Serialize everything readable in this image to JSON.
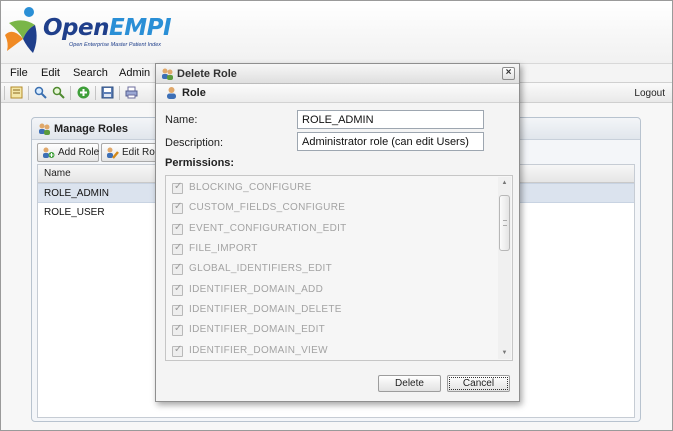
{
  "app": {
    "logo_text_a": "Open",
    "logo_text_b": "EMPI",
    "logo_subtitle": "Open Enterprise Master Patient Index",
    "brand_colors": {
      "dark_blue": "#1f3f8b",
      "light_blue": "#2a8fd6",
      "green": "#7ab648",
      "orange": "#f08a24"
    }
  },
  "menu": {
    "items": [
      "File",
      "Edit",
      "Search",
      "Admin"
    ]
  },
  "toolbar": {
    "icons": [
      "report-icon",
      "search-icon",
      "advanced-search-icon",
      "add-icon",
      "save-icon",
      "print-icon"
    ],
    "logout_label": "Logout"
  },
  "manage_roles": {
    "title": "Manage Roles",
    "add_role_label": "Add Role",
    "edit_role_label": "Edit Role",
    "column_name": "Name",
    "rows": [
      {
        "name": "ROLE_ADMIN",
        "selected": true
      },
      {
        "name": "ROLE_USER",
        "selected": false
      }
    ]
  },
  "dialog": {
    "title": "Delete Role",
    "section_title": "Role",
    "name_label": "Name:",
    "name_value": "ROLE_ADMIN",
    "description_label": "Description:",
    "description_value": "Administrator role (can edit Users)",
    "permissions_label": "Permissions:",
    "permissions": [
      {
        "label": "BLOCKING_CONFIGURE",
        "checked": true
      },
      {
        "label": "CUSTOM_FIELDS_CONFIGURE",
        "checked": true
      },
      {
        "label": "EVENT_CONFIGURATION_EDIT",
        "checked": true
      },
      {
        "label": "FILE_IMPORT",
        "checked": true
      },
      {
        "label": "GLOBAL_IDENTIFIERS_EDIT",
        "checked": true
      },
      {
        "label": "IDENTIFIER_DOMAIN_ADD",
        "checked": true
      },
      {
        "label": "IDENTIFIER_DOMAIN_DELETE",
        "checked": true
      },
      {
        "label": "IDENTIFIER_DOMAIN_EDIT",
        "checked": true
      },
      {
        "label": "IDENTIFIER_DOMAIN_VIEW",
        "checked": true
      }
    ],
    "delete_label": "Delete",
    "cancel_label": "Cancel",
    "close_glyph": "×"
  }
}
